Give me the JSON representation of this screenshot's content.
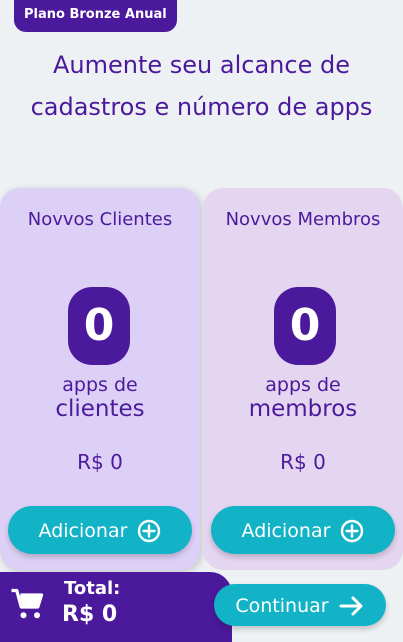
{
  "header": {
    "plan_badge": "Plano Bronze Anual",
    "headline": "Aumente seu alcance de cadastros e número de apps"
  },
  "cards": [
    {
      "title": "Novvos Clientes",
      "count": "0",
      "unit_line1": "apps de",
      "unit_line2": "clientes",
      "price": "R$ 0",
      "add_label": "Adicionar"
    },
    {
      "title": "Novvos Membros",
      "count": "0",
      "unit_line1": "apps de",
      "unit_line2": "membros",
      "price": "R$ 0",
      "add_label": "Adicionar"
    }
  ],
  "footer": {
    "total_label": "Total:",
    "total_value": "R$ 0",
    "continue_label": "Continuar"
  },
  "colors": {
    "primary": "#4b1a9c",
    "accent": "#12b3c6"
  },
  "icons": {
    "cart": "cart-icon",
    "plus": "plus-circle-icon",
    "arrow": "arrow-right-icon"
  }
}
